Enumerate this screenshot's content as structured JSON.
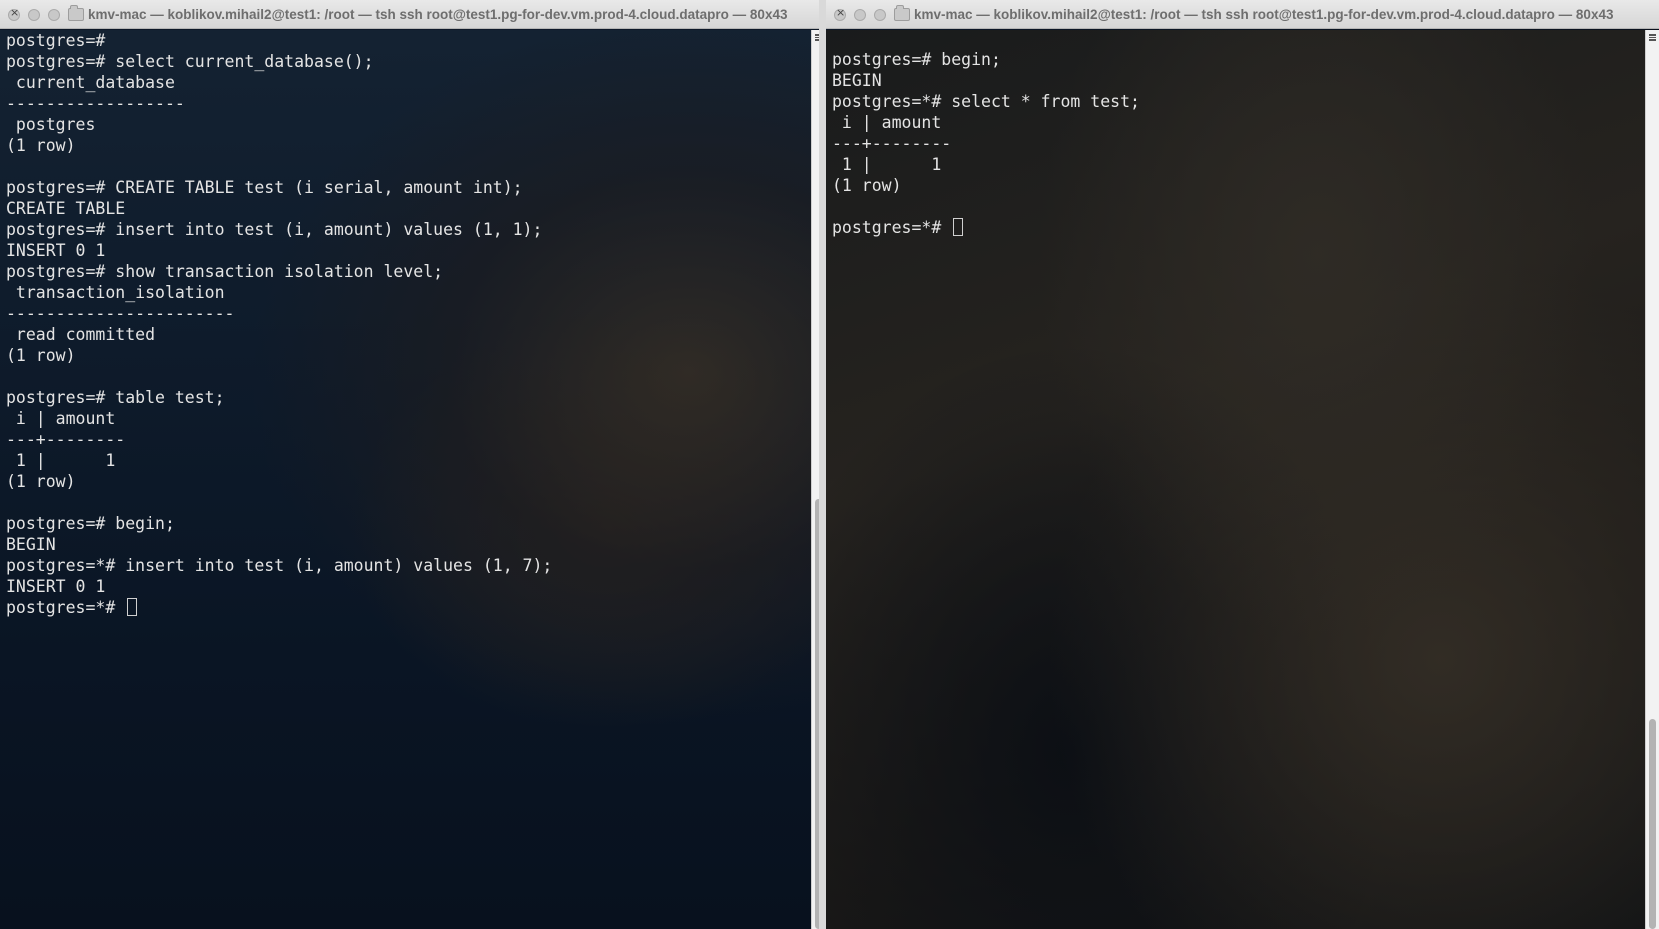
{
  "left_terminal": {
    "title": "kmv-mac — koblikov.mihail2@test1: /root — tsh ssh root@test1.pg-for-dev.vm.prod-4.cloud.datapro — 80x43",
    "lines": [
      "postgres=#",
      "postgres=# select current_database();",
      " current_database",
      "------------------",
      " postgres",
      "(1 row)",
      "",
      "postgres=# CREATE TABLE test (i serial, amount int);",
      "CREATE TABLE",
      "postgres=# insert into test (i, amount) values (1, 1);",
      "INSERT 0 1",
      "postgres=# show transaction isolation level;",
      " transaction_isolation",
      "-----------------------",
      " read committed",
      "(1 row)",
      "",
      "postgres=# table test;",
      " i | amount",
      "---+--------",
      " 1 |      1",
      "(1 row)",
      "",
      "postgres=# begin;",
      "BEGIN",
      "postgres=*# insert into test (i, amount) values (1, 7);",
      "INSERT 0 1"
    ],
    "prompt": "postgres=*# "
  },
  "right_terminal": {
    "title": "kmv-mac — koblikov.mihail2@test1: /root — tsh ssh root@test1.pg-for-dev.vm.prod-4.cloud.datapro — 80x43",
    "lines": [
      "postgres=# begin;",
      "BEGIN",
      "postgres=*# select * from test;",
      " i | amount",
      "---+--------",
      " 1 |      1",
      "(1 row)",
      ""
    ],
    "prompt": "postgres=*# "
  }
}
